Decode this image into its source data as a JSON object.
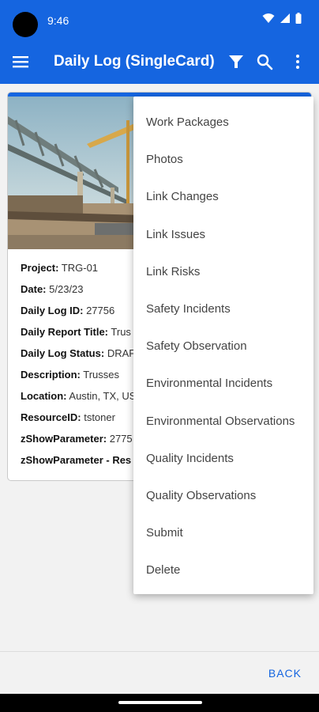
{
  "status_bar": {
    "time": "9:46"
  },
  "app_bar": {
    "title": "Daily Log (SingleCard)"
  },
  "card": {
    "fields": [
      {
        "label": "Project:",
        "value": "TRG-01"
      },
      {
        "label": "Date:",
        "value": "5/23/23"
      },
      {
        "label": "Daily Log ID:",
        "value": "27756"
      },
      {
        "label": "Daily Report Title:",
        "value": "Trus"
      },
      {
        "label": "Daily Log Status:",
        "value": "DRAF"
      },
      {
        "label": "Description:",
        "value": "Trusses"
      },
      {
        "label": "Location:",
        "value": "Austin, TX, US"
      },
      {
        "label": "ResourceID:",
        "value": "tstoner"
      },
      {
        "label": "zShowParameter:",
        "value": "2775"
      },
      {
        "label": "zShowParameter - Res",
        "value": ""
      }
    ]
  },
  "menu": {
    "items": [
      "Work Packages",
      "Photos",
      "Link Changes",
      "Link Issues",
      "Link Risks",
      "Safety Incidents",
      "Safety Observation",
      "Environmental Incidents",
      "Environmental Observations",
      "Quality Incidents",
      "Quality Observations",
      "Submit",
      "Delete"
    ]
  },
  "footer": {
    "back_label": "BACK"
  },
  "colors": {
    "primary": "#1565e0",
    "background": "#f2f2f2"
  },
  "icons": [
    "wifi-icon",
    "signal-icon",
    "battery-icon",
    "hamburger-menu-icon",
    "filter-icon",
    "search-icon",
    "more-vert-icon"
  ]
}
